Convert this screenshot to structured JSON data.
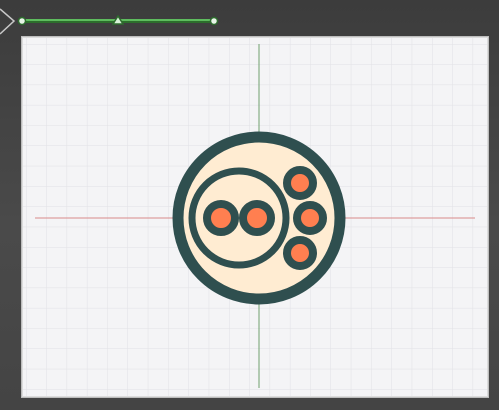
{
  "editor": {
    "canvas": {
      "background_color": "#f4f4f6",
      "grid_color": "#e3e3e6",
      "grid": true
    },
    "axes": {
      "horizontal_color": "#d98080",
      "vertical_color": "#6f9f6f"
    },
    "timeline_slider": {
      "color": "#4caf50",
      "handle_fill": "#2e6b2e",
      "marker": "triangle",
      "value": 0.5
    },
    "artwork": {
      "outline_color": "#2f4f4f",
      "fill_color": "#ffecd2",
      "dot_color": "#ff7f50",
      "shapes": [
        "outer-circle",
        "inner-ring",
        "dot-left",
        "dot-center",
        "dot-top-right",
        "dot-right",
        "dot-bottom-right"
      ]
    },
    "icons": {
      "menu_corner": "chevron-icon",
      "slider_start": "node-start-icon",
      "slider_mid": "triangle-marker-icon",
      "slider_end": "node-end-icon"
    }
  }
}
